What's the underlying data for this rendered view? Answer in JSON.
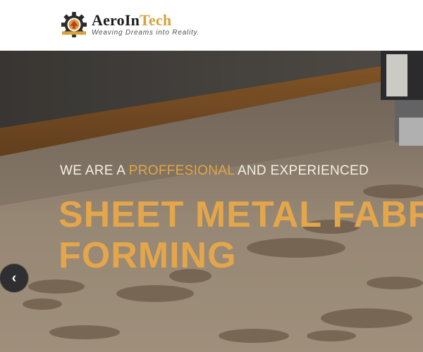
{
  "header": {
    "brand_part1": "AeroIn",
    "brand_part2": "Tech",
    "tagline": "Weaving Dreams into Reality.",
    "logo_icon": "gear-logo-icon",
    "accent_color": "#d6a23a"
  },
  "hero": {
    "kicker_prefix": "WE ARE A ",
    "kicker_highlight": "PROFFESIONAL",
    "kicker_suffix": " AND EXPERIENCED",
    "headline_line1": "SHEET METAL FABRICATION",
    "headline_line2": "FORMING",
    "prev_arrow_icon": "chevron-left-icon",
    "prev_arrow_glyph": "‹",
    "headline_color": "#e3a64a"
  }
}
